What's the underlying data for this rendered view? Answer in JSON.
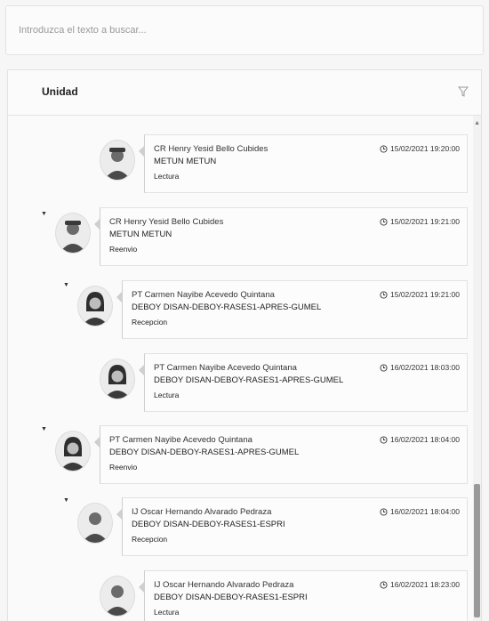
{
  "search": {
    "placeholder": "Introduzca el texto a buscar..."
  },
  "panel": {
    "title": "Unidad"
  },
  "messages": [
    {
      "name": "CR Henry Yesid Bello Cubides",
      "unit": "METUN METUN",
      "action": "Lectura",
      "time": "15/02/2021 19:20:00",
      "avatar": "male-officer"
    },
    {
      "name": "CR Henry Yesid Bello Cubides",
      "unit": "METUN METUN",
      "action": "Reenvio",
      "time": "15/02/2021 19:21:00",
      "avatar": "male-officer"
    },
    {
      "name": "PT Carmen Nayibe Acevedo Quintana",
      "unit": "DEBOY DISAN-DEBOY-RASES1-APRES-GUMEL",
      "action": "Recepcion",
      "time": "15/02/2021 19:21:00",
      "avatar": "female-officer"
    },
    {
      "name": "PT Carmen Nayibe Acevedo Quintana",
      "unit": "DEBOY DISAN-DEBOY-RASES1-APRES-GUMEL",
      "action": "Lectura",
      "time": "16/02/2021 18:03:00",
      "avatar": "female-officer"
    },
    {
      "name": "PT Carmen Nayibe Acevedo Quintana",
      "unit": "DEBOY DISAN-DEBOY-RASES1-APRES-GUMEL",
      "action": "Reenvio",
      "time": "16/02/2021 18:04:00",
      "avatar": "female-officer"
    },
    {
      "name": "IJ Oscar Hernando Alvarado Pedraza",
      "unit": "DEBOY DISAN-DEBOY-RASES1-ESPRI",
      "action": "Recepcion",
      "time": "16/02/2021 18:04:00",
      "avatar": "male-officer"
    },
    {
      "name": "IJ Oscar Hernando Alvarado Pedraza",
      "unit": "DEBOY DISAN-DEBOY-RASES1-ESPRI",
      "action": "Lectura",
      "time": "16/02/2021 18:23:00",
      "avatar": "male-officer"
    }
  ]
}
